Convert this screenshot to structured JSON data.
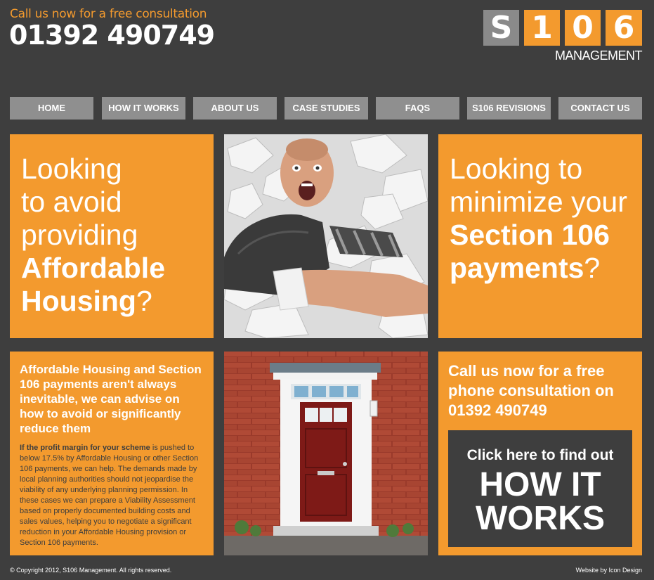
{
  "header": {
    "tagline": "Call us now for a free consultation",
    "phone": "01392 490749"
  },
  "logo": {
    "letters": [
      "S",
      "1",
      "0",
      "6"
    ],
    "subtitle": "MANAGEMENT"
  },
  "nav": {
    "items": [
      {
        "label": "HOME"
      },
      {
        "label": "HOW IT WORKS"
      },
      {
        "label": "ABOUT US"
      },
      {
        "label": "CASE STUDIES"
      },
      {
        "label": "FAQS"
      },
      {
        "label": "S106 REVISIONS"
      },
      {
        "label": "CONTACT US"
      }
    ]
  },
  "panels": {
    "left_question": {
      "line1": "Looking",
      "line2": "to avoid",
      "line3": "providing",
      "line4_bold": "Affordable",
      "line5_bold": "Housing",
      "line5_end": "?"
    },
    "right_question": {
      "line1": "Looking to",
      "line2": "minimize your",
      "line3_bold": "Section 106",
      "line4_bold": "payments",
      "line4_end": "?"
    },
    "info": {
      "heading": "Affordable Housing and Section 106 payments aren't always inevitable, we can advise on how to avoid or significantly reduce them",
      "body_bold": "If the profit margin for your scheme",
      "body": " is pushed to below 17.5% by Affordable Housing or other Section 106 payments, we can help. The demands made by local planning authorities should not jeopardise the viability of any underlying planning permission. In these cases we can prepare a Viability Assessment based on properly documented building costs and sales values, helping you to negotiate a significant reduction in your Affordable Housing provision or Section 106 payments."
    },
    "cta": {
      "text": "Call us now for a free phone consultation on 01392 490749",
      "button_small": "Click here to find out",
      "button_big_1": "HOW IT",
      "button_big_2": "WORKS"
    }
  },
  "footer": {
    "copyright": "© Copyright 2012, S106 Management. All rights reserved.",
    "credit": "Website by Icon Design"
  },
  "colors": {
    "background": "#3e3e3e",
    "accent": "#f39a2e",
    "nav": "#8f8f8f"
  }
}
